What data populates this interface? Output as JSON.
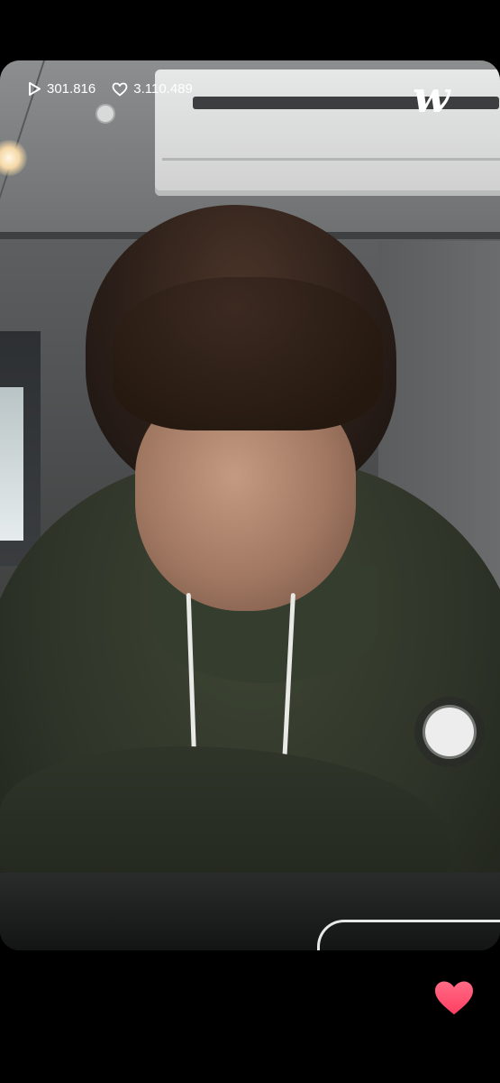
{
  "stats": {
    "plays": "301.816",
    "likes": "3.110.489"
  },
  "brand": {
    "logo_text": "w"
  },
  "icons": {
    "play": "play-outline-icon",
    "like": "heart-outline-icon",
    "heart": "heart-filled-icon"
  },
  "colors": {
    "heart": "#ff4f6d",
    "text": "#ffffff",
    "background": "#000000"
  }
}
